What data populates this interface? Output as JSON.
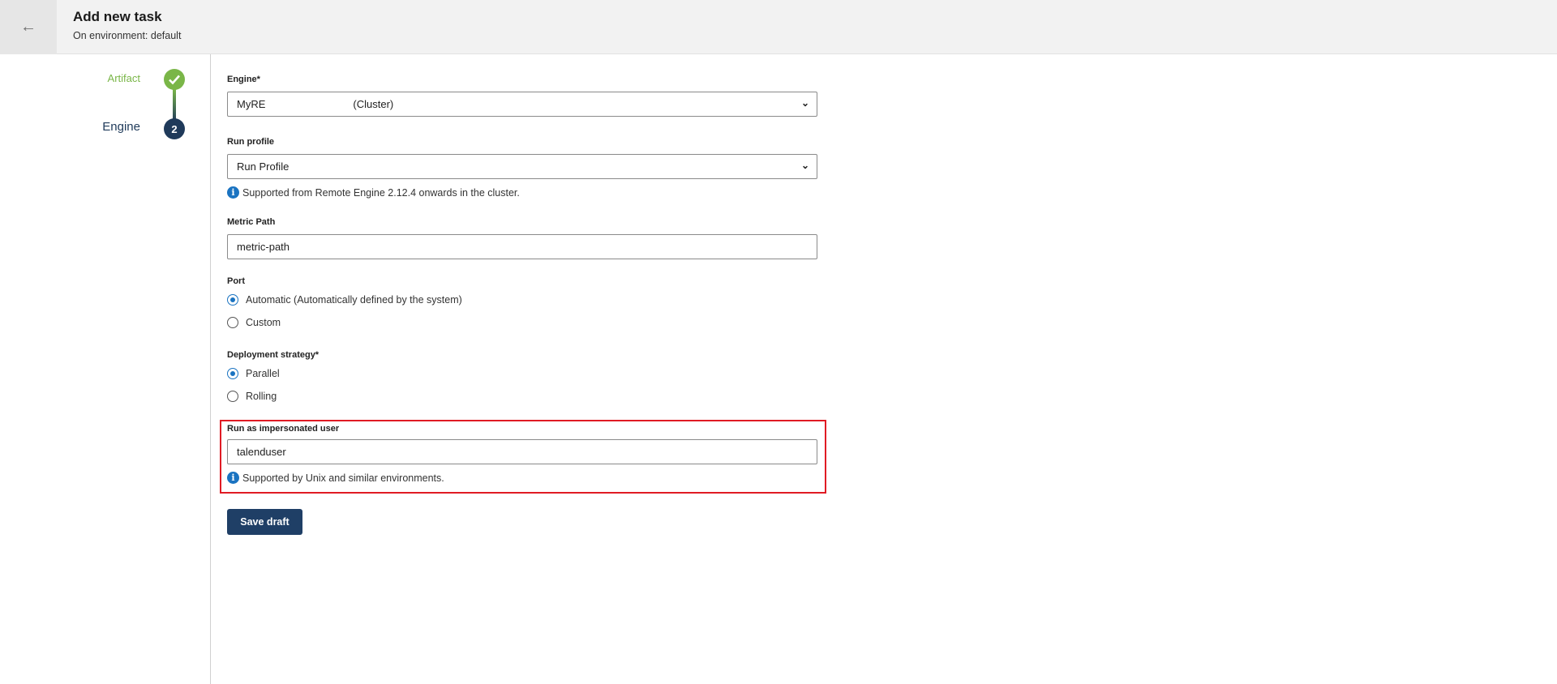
{
  "header": {
    "title": "Add new task",
    "subtitle": "On environment: default"
  },
  "stepper": {
    "steps": [
      {
        "label": "Artifact",
        "state": "done"
      },
      {
        "label": "Engine",
        "number": "2",
        "state": "active"
      }
    ]
  },
  "form": {
    "engine": {
      "label": "Engine*",
      "value_name": "MyRE",
      "value_type": "(Cluster)"
    },
    "run_profile": {
      "label": "Run profile",
      "value": "Run Profile",
      "info": "Supported from Remote Engine 2.12.4 onwards in the cluster."
    },
    "metric_path": {
      "label": "Metric Path",
      "value": "metric-path"
    },
    "port": {
      "label": "Port",
      "options": [
        {
          "label": "Automatic (Automatically defined by the system)",
          "checked": true
        },
        {
          "label": "Custom",
          "checked": false
        }
      ]
    },
    "deployment": {
      "label": "Deployment strategy*",
      "options": [
        {
          "label": "Parallel",
          "checked": true
        },
        {
          "label": "Rolling",
          "checked": false
        }
      ]
    },
    "impersonated": {
      "label": "Run as impersonated user",
      "value": "talenduser",
      "info": "Supported by Unix and similar environments."
    },
    "save_label": "Save draft"
  },
  "colors": {
    "accent": "#1a73c1",
    "primary": "#1f3f66",
    "success": "#7ab648",
    "highlight": "#e01b24"
  }
}
